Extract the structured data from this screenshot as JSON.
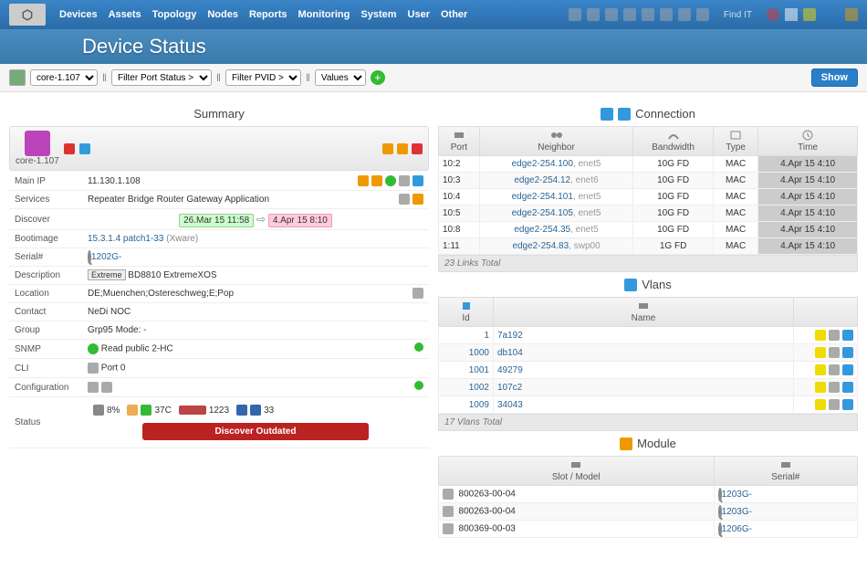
{
  "nav": {
    "items": [
      "Devices",
      "Assets",
      "Topology",
      "Nodes",
      "Reports",
      "Monitoring",
      "System",
      "User",
      "Other"
    ],
    "find": "Find IT"
  },
  "title": "Device Status",
  "filters": {
    "device": "core-1.107",
    "f1": "Filter Port Status >",
    "f2": "Filter PVID >",
    "f3": "Values",
    "show": "Show"
  },
  "summary": {
    "title": "Summary",
    "devname": "core-1.107",
    "rows": {
      "mainip_k": "Main IP",
      "mainip_v": "11.130.1.108",
      "services_k": "Services",
      "services_v": "Repeater Bridge Router Gateway Application",
      "discover_k": "Discover",
      "discover_d1": "26.Mar 15 11:58",
      "discover_d2": "4.Apr 15 8:10",
      "bootimage_k": "Bootimage",
      "bootimage_v": "15.3.1.4 patch1-33",
      "bootimage_x": "(Xware)",
      "serial_k": "Serial#",
      "serial_v": "1202G-",
      "desc_k": "Description",
      "desc_badge": "Extreme",
      "desc_v": "BD8810 ExtremeXOS",
      "loc_k": "Location",
      "loc_v": "DE;Muenchen;Ostereschweg;E;Pop",
      "contact_k": "Contact",
      "contact_v": "NeDi NOC",
      "group_k": "Group",
      "group_v": "Grp95 Mode: -",
      "snmp_k": "SNMP",
      "snmp_v": "Read public 2-HC",
      "cli_k": "CLI",
      "cli_v": "Port 0",
      "config_k": "Configuration",
      "status_k": "Status",
      "cpu": "8%",
      "temp": "37C",
      "mem": "1223",
      "if": "33",
      "outdated": "Discover Outdated"
    }
  },
  "connection": {
    "title": "Connection",
    "headers": [
      "Port",
      "Neighbor",
      "Bandwidth",
      "Type",
      "Time"
    ],
    "rows": [
      {
        "port": "10:2",
        "nb": "edge2-254.100",
        "nif": ", enet5",
        "bw": "10G FD",
        "type": "MAC",
        "time": "4.Apr 15 4:10"
      },
      {
        "port": "10:3",
        "nb": "edge2-254.12",
        "nif": ", enet6",
        "bw": "10G FD",
        "type": "MAC",
        "time": "4.Apr 15 4:10"
      },
      {
        "port": "10:4",
        "nb": "edge2-254.101",
        "nif": ", enet5",
        "bw": "10G FD",
        "type": "MAC",
        "time": "4.Apr 15 4:10"
      },
      {
        "port": "10:5",
        "nb": "edge2-254.105",
        "nif": ", enet5",
        "bw": "10G FD",
        "type": "MAC",
        "time": "4.Apr 15 4:10"
      },
      {
        "port": "10:8",
        "nb": "edge2-254.35",
        "nif": ", enet5",
        "bw": "10G FD",
        "type": "MAC",
        "time": "4.Apr 15 4:10"
      },
      {
        "port": "1:11",
        "nb": "edge2-254.83",
        "nif": ", swp00",
        "bw": "1G FD",
        "type": "MAC",
        "time": "4.Apr 15 4:10"
      }
    ],
    "total": "23 Links Total"
  },
  "vlans": {
    "title": "Vlans",
    "headers": [
      "Id",
      "Name"
    ],
    "rows": [
      {
        "id": "1",
        "name": "7a192"
      },
      {
        "id": "1000",
        "name": "db104"
      },
      {
        "id": "1001",
        "name": "49279"
      },
      {
        "id": "1002",
        "name": "107c2"
      },
      {
        "id": "1009",
        "name": "34043"
      }
    ],
    "total": "17 Vlans Total"
  },
  "module": {
    "title": "Module",
    "headers": [
      "Slot / Model",
      "Serial#"
    ],
    "rows": [
      {
        "slot": "800263-00-04",
        "serial": "1203G-"
      },
      {
        "slot": "800263-00-04",
        "serial": "1203G-"
      },
      {
        "slot": "800369-00-03",
        "serial": "1206G-"
      }
    ]
  }
}
